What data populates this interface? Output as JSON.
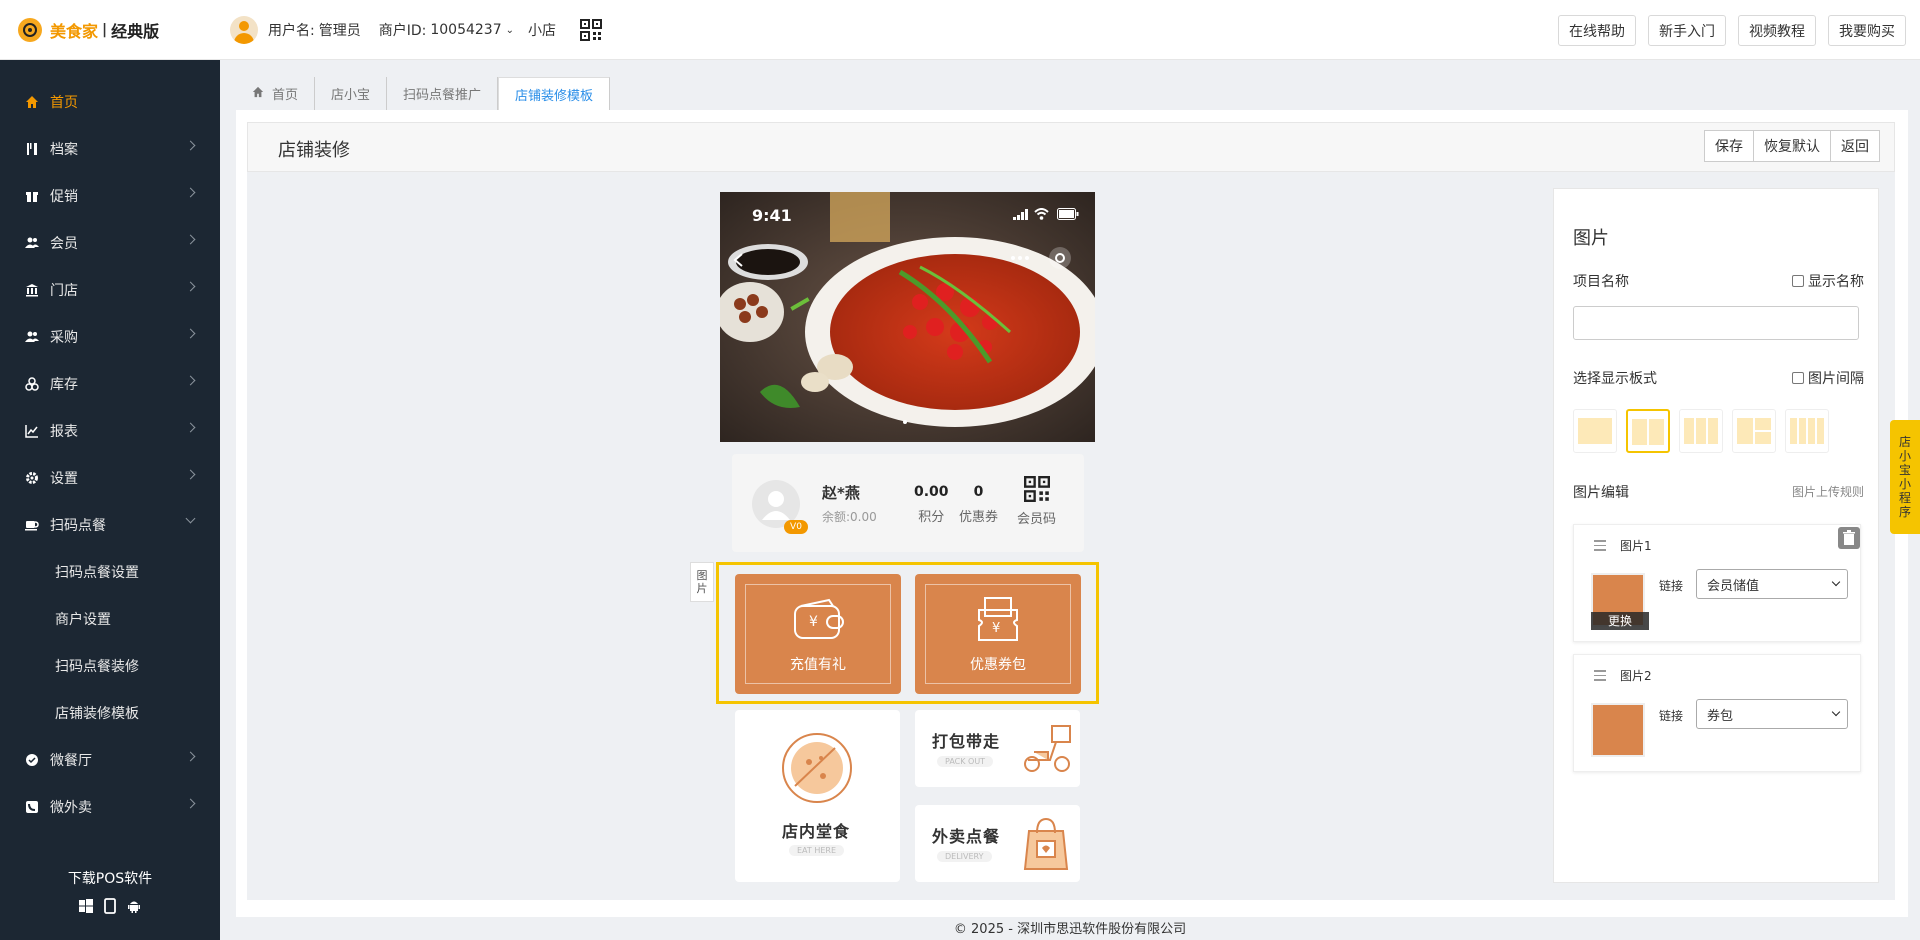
{
  "header": {
    "brand": "美食家",
    "separator": "|",
    "edition": "经典版",
    "user_label": "用户名:",
    "user_name": "管理员",
    "merchant_label": "商户ID:",
    "merchant_id": "10054237",
    "store": "小店",
    "buttons": [
      "在线帮助",
      "新手入门",
      "视频教程",
      "我要购买"
    ]
  },
  "sidebar": {
    "items": [
      {
        "label": "首页",
        "icon": "home-icon"
      },
      {
        "label": "档案",
        "icon": "utensils-icon"
      },
      {
        "label": "促销",
        "icon": "gift-icon"
      },
      {
        "label": "会员",
        "icon": "users-icon"
      },
      {
        "label": "门店",
        "icon": "bank-icon"
      },
      {
        "label": "采购",
        "icon": "users-icon"
      },
      {
        "label": "库存",
        "icon": "cubes-icon"
      },
      {
        "label": "报表",
        "icon": "line-chart-icon"
      },
      {
        "label": "设置",
        "icon": "gear-icon"
      },
      {
        "label": "扫码点餐",
        "icon": "coffee-icon"
      }
    ],
    "sub_items": [
      "扫码点餐设置",
      "商户设置",
      "扫码点餐装修",
      "店铺装修模板"
    ],
    "more_items": [
      {
        "label": "微餐厅",
        "icon": "wechat-icon"
      },
      {
        "label": "微外卖",
        "icon": "phone-icon"
      }
    ],
    "download": "下载POS软件"
  },
  "tabs": [
    "首页",
    "店小宝",
    "扫码点餐推广",
    "店铺装修模板"
  ],
  "panel": {
    "title": "店铺装修",
    "buttons": [
      "保存",
      "恢复默认",
      "返回"
    ]
  },
  "phone": {
    "time": "9:41",
    "member_name": "赵*燕",
    "balance": "余额:0.00",
    "badge": "V0",
    "stats": [
      {
        "value": "0.00",
        "label": "积分"
      },
      {
        "value": "0",
        "label": "优惠券"
      }
    ],
    "member_code_label": "会员码",
    "side_tag": [
      "图",
      "片"
    ],
    "orange_cards": [
      "充值有礼",
      "优惠券包"
    ],
    "dine_in": {
      "title": "店内堂食",
      "sub": "EAT HERE"
    },
    "pack_out": {
      "title": "打包带走",
      "sub": "PACK OUT"
    },
    "delivery": {
      "title": "外卖点餐",
      "sub": "DELIVERY"
    }
  },
  "settings": {
    "title": "图片",
    "item_name_label": "项目名称",
    "show_name": "显示名称",
    "layout_label": "选择显示板式",
    "image_gap": "图片间隔",
    "image_edit": "图片编辑",
    "upload_rules": "图片上传规则",
    "images": [
      {
        "name": "图片1",
        "link_label": "链接",
        "link": "会员储值",
        "replace": "更换"
      },
      {
        "name": "图片2",
        "link_label": "链接",
        "link": "券包"
      }
    ]
  },
  "float_tab": [
    "店",
    "小",
    "宝",
    "小",
    "程",
    "序"
  ],
  "footer": "© 2025 - 深圳市思迅软件股份有限公司",
  "colors": {
    "accent": "#f39800",
    "sidebar": "#1c2733",
    "tab_active": "#2a8ee8",
    "card_orange": "#d9854c",
    "highlight": "#f5c400"
  }
}
